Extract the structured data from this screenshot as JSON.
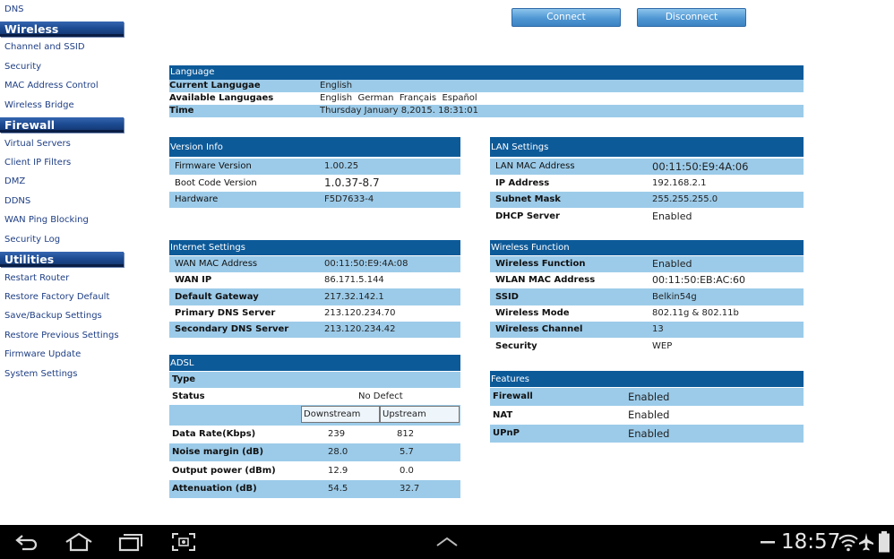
{
  "sidebar": {
    "top_link": "DNS",
    "sections": [
      {
        "title": "Wireless",
        "items": [
          "Channel and SSID",
          "Security",
          "MAC Address Control",
          "Wireless Bridge"
        ]
      },
      {
        "title": "Firewall",
        "items": [
          "Virtual Servers",
          "Client IP Filters",
          "DMZ",
          "DDNS",
          "WAN Ping Blocking",
          "Security Log"
        ]
      },
      {
        "title": "Utilities",
        "items": [
          "Restart Router",
          "Restore Factory Default",
          "Save/Backup Settings",
          "Restore Previous Settings",
          "Firmware Update",
          "System Settings"
        ]
      }
    ]
  },
  "buttons": {
    "connect": "Connect",
    "disconnect": "Disconnect"
  },
  "language": {
    "title": "Language",
    "rows": [
      {
        "label": "Current Langugae",
        "value": "English"
      },
      {
        "label": "Available Langugaes",
        "value": "English  German  Français  Español"
      },
      {
        "label": "Time",
        "value": "Thursday January 8,2015. 18:31:01"
      }
    ]
  },
  "version_info": {
    "title": "Version Info",
    "rows": [
      {
        "label": "Firmware Version",
        "value": "1.00.25"
      },
      {
        "label": "Boot Code Version",
        "value": "1.0.37-8.7"
      },
      {
        "label": "Hardware",
        "value": "F5D7633-4"
      }
    ]
  },
  "lan_settings": {
    "title": "LAN Settings",
    "rows": [
      {
        "label": "LAN MAC Address",
        "value": "00:11:50:E9:4A:06"
      },
      {
        "label": "IP Address",
        "value": "192.168.2.1"
      },
      {
        "label": "Subnet Mask",
        "value": "255.255.255.0"
      },
      {
        "label": "DHCP Server",
        "value": "Enabled"
      }
    ]
  },
  "internet_settings": {
    "title": "Internet Settings",
    "rows": [
      {
        "label": "WAN MAC Address",
        "value": "00:11:50:E9:4A:08"
      },
      {
        "label": "WAN IP",
        "value": "86.171.5.144"
      },
      {
        "label": "Default Gateway",
        "value": "217.32.142.1"
      },
      {
        "label": "Primary DNS Server",
        "value": "213.120.234.70"
      },
      {
        "label": "Secondary DNS Server",
        "value": "213.120.234.42"
      }
    ]
  },
  "wireless_function": {
    "title": "Wireless Function",
    "rows": [
      {
        "label": "Wireless Function",
        "value": "Enabled"
      },
      {
        "label": "WLAN MAC Address",
        "value": "00:11:50:EB:AC:60"
      },
      {
        "label": "SSID",
        "value": "Belkin54g"
      },
      {
        "label": "Wireless Mode",
        "value": "802.11g & 802.11b"
      },
      {
        "label": "Wireless Channel",
        "value": "13"
      },
      {
        "label": "Security",
        "value": "WEP"
      }
    ]
  },
  "adsl": {
    "title": "ADSL",
    "type_label": "Type",
    "status_label": "Status",
    "status_value": "No Defect",
    "col_downstream": "Downstream",
    "col_upstream": "Upstream",
    "rows": [
      {
        "label": "Data Rate(Kbps)",
        "down": "239",
        "up": "812"
      },
      {
        "label": "Noise margin (dB)",
        "down": "28.0",
        "up": "5.7"
      },
      {
        "label": "Output power (dBm)",
        "down": "12.9",
        "up": "0.0"
      },
      {
        "label": "Attenuation (dB)",
        "down": "54.5",
        "up": "32.7"
      }
    ]
  },
  "features": {
    "title": "Features",
    "rows": [
      {
        "label": "Firewall",
        "value": "Enabled"
      },
      {
        "label": "NAT",
        "value": "Enabled"
      },
      {
        "label": "UPnP",
        "value": "Enabled"
      }
    ]
  },
  "system_bar": {
    "clock": "18:57"
  },
  "colors": {
    "panel_title": "#0d5a99",
    "row_shade": "#9ccbe9",
    "sidebar_header": "#1c4a92",
    "link": "#1f3f85"
  }
}
